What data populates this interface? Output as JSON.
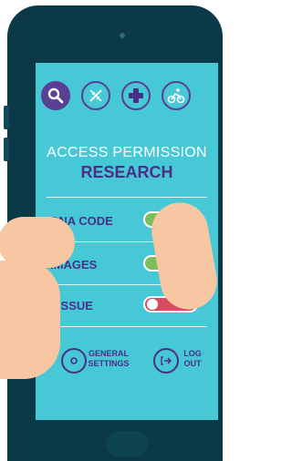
{
  "app": {
    "title_line1": "ACCESS PERMISSION",
    "title_line2": "RESEARCH"
  },
  "nav_icons": [
    {
      "name": "search-icon",
      "active": true
    },
    {
      "name": "dna-icon",
      "active": false
    },
    {
      "name": "medical-cross-icon",
      "active": false
    },
    {
      "name": "cyclist-icon",
      "active": false
    }
  ],
  "permissions": [
    {
      "label": "DNA CODE",
      "enabled": true
    },
    {
      "label": "IMAGES",
      "enabled": true
    },
    {
      "label": "TISSUE",
      "enabled": false
    }
  ],
  "footer": {
    "settings_line1": "GENERAL",
    "settings_line2": "SETTINGS",
    "logout_line1": "LOG",
    "logout_line2": "OUT"
  },
  "colors": {
    "screen_bg": "#46c8d7",
    "accent": "#5a3f94",
    "toggle_on": "#7cbf5a",
    "toggle_off": "#d94a63",
    "phone_body": "#0b3a46"
  }
}
